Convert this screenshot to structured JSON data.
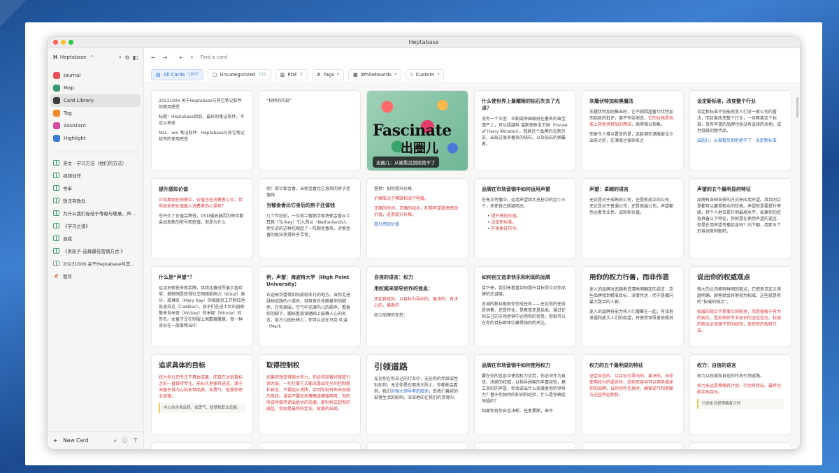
{
  "window": {
    "title": "Heptabase"
  },
  "sidebar": {
    "workspace": "Heptabase",
    "nav": [
      {
        "label": "Journal",
        "icon": "journal-icon",
        "color": "#e8505b"
      },
      {
        "label": "Map",
        "icon": "map-icon",
        "color": "#3a9a6a"
      },
      {
        "label": "Card Library",
        "icon": "card-library-icon",
        "color": "#3b3b3b"
      },
      {
        "label": "Tag",
        "icon": "tag-icon",
        "color": "#f08a24"
      },
      {
        "label": "Assistant",
        "icon": "assistant-icon",
        "color": "#d94ba0"
      },
      {
        "label": "Highlight",
        "icon": "highlight-icon",
        "color": "#3a7bd5"
      }
    ],
    "pages": [
      "英文 - 学习方法（他们的方法）",
      "视频创作",
      "书单",
      "想法存放处",
      "为什么我们标结于等级与敬意、声…",
      "《学习之道》",
      "自我",
      "《卖轮子-选择最佳营销方式 》",
      "20231006 关于Heptabase与其…",
      "我写"
    ],
    "new_card": "New Card"
  },
  "toolbar": {
    "search_placeholder": "Find a card"
  },
  "filters": {
    "all_cards": "All Cards",
    "all_count": "1867",
    "uncategorized": "Uncategorized",
    "uncat_count": "162",
    "pdf": "PDF",
    "pdf_count": "5",
    "tags": "Tags",
    "whiteboards": "Whiteboards",
    "custom": "Custom"
  },
  "cards": {
    "c1": {
      "b1": "20231006 关于Heptabase与其它笔记软件的使用感受",
      "b2": "标题：Heptabase目前，最好的笔记软件，不足以表述",
      "b3": "Mac、win 笔记软件：Heptabase与其它笔记软件的使用感受"
    },
    "c2": {
      "b1": "“棺材的内部”"
    },
    "c3": {
      "title": "Fascinate",
      "cn": "出圈儿",
      "caption": "出圈儿：从被看见到拒绝不了"
    },
    "c4": {
      "title": "什么使世界上最耀眼的钻石失去了光泽？",
      "b1": "没有一个王室、王朝或帝国政府在著名的珠宝遗产上，可以超越科·温斯顿珠宝王国（House of Harry Winston）。回顾这个品牌的光荣历史，出现过很多著名的钻石，以及钻石的佩戴者。"
    },
    "c5": {
      "title": "灰履伏特加和黑魔法",
      "b1": "灰履伏特加刚推出时，它不顾因超奢华伏特加而招致的批评，毫不夸张地说，",
      "b2": "它的价格是苦架上其他伏特加的两倍，",
      "b3": "高得难以想象。",
      "b4": "而更令人难以置信的是，这款酒在酒瓶被设计出来之前，在酒液之被命名之"
    },
    "c6": {
      "title": "设定新标准，改变整个行业",
      "b1": "设定新标准不仅能改变人们对一家公司的看法，而且能改变整个行业，一旦教离这个标准，享有声望的品牌也会没有选择的余地，成为低级的替代品。",
      "b2": "出圈儿：从被看见到拒绝不了 · 设定新标准"
    },
    "c7": {
      "title": "提升感知价值",
      "b1": "正如奥丽在观察中，价值也在消费者心中。但你如何把价值植入消费者的心里呢？",
      "b2": "车开久了价值会降低，DVD播放器因为每年都会出现新的型号而贬值。但是为什么"
    },
    "c8": {
      "b1": "例：荷兰郁金香，当郁金香比它身后的房子还值钱",
      "title": "当郁金香比它身后的房子还值钱",
      "b2": "几个世纪前，一位荷兰植物学家将郁金香从土耳其（Turkey）引入荷兰（Netherlands）。他引进的这种花掀起了一阵郁金香热。对郁金香的疯狂变得异乎寻常，"
    },
    "c9": {
      "b1": "营销：如何提升价格",
      "b2": "价格取决于稀缺和流行程度。",
      "b3": "正确的时间、正确的组合，利用声望提高感知价值，进而提升价格。",
      "link": "提升感知价值"
    },
    "c10": {
      "title": "品牌在市场营销中如何运用声望",
      "b1": "在每次传播中，运用声望四大支柱中的至少三个，来使自己脱颖而出：",
      "li1": "提升感知价值。",
      "li2": "设定新标准。",
      "li3": "开发象征符号。"
    },
    "c11": {
      "title": "声望：卓越的语言",
      "b1": "无论是对于成熟的公司，还是新成立的公司，无论是对于普通公司，还是高端公司，声望都传达着专业性、成就和价值。"
    },
    "c12": {
      "title": "声望的五个最明显的特征",
      "b1": "品牌有各种各样的方式来应用声望。其共同点是都可以赢得观众的钦佩。声望就是要提升等级，将个人地位提升到最高水平。如果你的信息具备以下特征，你就是在使用声望的语言。你是在用声望传播信息吗？向下翻，用那五个形容词来判断吧。"
    },
    "c13": {
      "title": "什么是“声望”？",
      "b1": "运动员斩获多枚奖牌，烘焙比赛冠军展示蓝丝带，推特网是获得社交网络影响力（Klout）高分、玫琳凯（Mary Kay）的高级员工开粉红色凯迪拉克（Cadillac），孩子们在迪士尼乐园收集来自米奇（Mickey）和米妮（Minnie）的签名。女童子军在制服上佩戴着徽章。每一种身份在一般事物当中"
    },
    "c14": {
      "title": "例，声望：海波特大学（High Point University）",
      "b1": "欢迎来到僵得如何成就非凡的地方。当你走进绿树成荫的小道时，轻爽音乐伴随着你的脚步。在你周围，空气中充满鸟儿的歌声，看着你的脚下，踢跃看摇读踏鸥上鼓舞人心的名言。前方公园长椅上，你可以坐在马克·吐温（Mark"
    },
    "c15": {
      "title": "自信的语言：权力",
      "t2": "用权威来领导创作的信息：",
      "b1": "坚定自信的、以目标为导向的、果决的、有决心的、果断的",
      "b2": "权力品牌的支柱："
    },
    "c16": {
      "title": "如何创立追求快乐和利润的品牌",
      "b1": "接下来，我们来看看如何提升目标受众对你品牌的忠诚度。",
      "b2": "忠诚的粉丝能助你完成任务——无论你的任务是销售、还是转化，是教育还是启发。通过在你自己的市场营销中运用你的优势，你就可以在你的目标群体中赢得强烈的关注。"
    },
    "c17": {
      "title": "用你的权力行善，而非作恶",
      "b1": "迷人的品牌对追随者说清晰明确定的语言，这些品牌找到精准目标、深度传达，而不是面向最大数目的人群。",
      "b2": "迷人的品牌有能力将人们凝聚在一起。有效地发掘和放大人们的欲望，并使受领导者依照其"
    },
    "c18": {
      "title": "说出你的权威观点",
      "b1": "强大的公司拥有鲜明的观点。它把意见定义得越明确，顾客就会将他视为权威。这些就是你的“权威的观点”。",
      "b2": "权威的观点不是事实的陈述，而是植根于有力的观点，是反映你专业知识的坚定信念。权威的观点必须源于你的经验，反映你的独特方法。"
    },
    "c19": {
      "title": "追求具体的目标",
      "b1": "权力型公司专注于具体成果，而且在达到目标之前一直保持专注。能长久地保持进态，源于深植于其内心的永恒品质，如勇气、智慧和职业道德。",
      "quote": "内心的永恒品质，如勇气、智慧和职业道德。"
    },
    "c20": {
      "title": "取得控制权",
      "b1": "如果你想变得强大有力，你必须准备好接管引领大局，一切行事方式都流露出完全的控制感和自信，不要屈从诱降，否则你就有失去权威的风险。讲话不要犹犹豫豫或模棱两可，你的所说所做传递出绝对的态度。即别树立起你的威信，你就是最终的定论、故事的结局。"
    },
    "c21": {
      "title": "引领道路",
      "b1": "无论你在你自己的行业中，无论你的年龄或性别如何，无论你是在哪块大陆上，你都能会看到，我们",
      "link": "对强大领导者的叙述",
      "b2": "，受我们曾经的部落生活的影响。深深地印在我们的灵魂中。"
    },
    "c22": {
      "title": "品牌在市场营销中如何使用权力",
      "b1": "要在你的信息中使用权力优势，你必须作为自信、决绝的权威，以指导顾客的丰富经验，建立良好的声誉，你会说出什么来激发你的领导力？基于你独特的知识和经验，什么是你确信无疑的？",
      "b2": "如果你有你自信决断、任者裹断，来不"
    },
    "c23": {
      "title": "权力的五个最明显的特征",
      "b1": "坚定自信的、以目标为导向的、果决的，当你使用权力的语言时，这些形容词可以用来描述你的品牌。当你创作信息时，确保语气和意图与这些特征相符。"
    },
    "c24": {
      "title": "权力：自信的语言",
      "b1": "权力以权威和自信的作风引领道路。",
      "b2": "权力永远是策略有计划，行动有目标。最终也能实现目标。",
      "quote": "行动永远是策略有计划"
    }
  }
}
